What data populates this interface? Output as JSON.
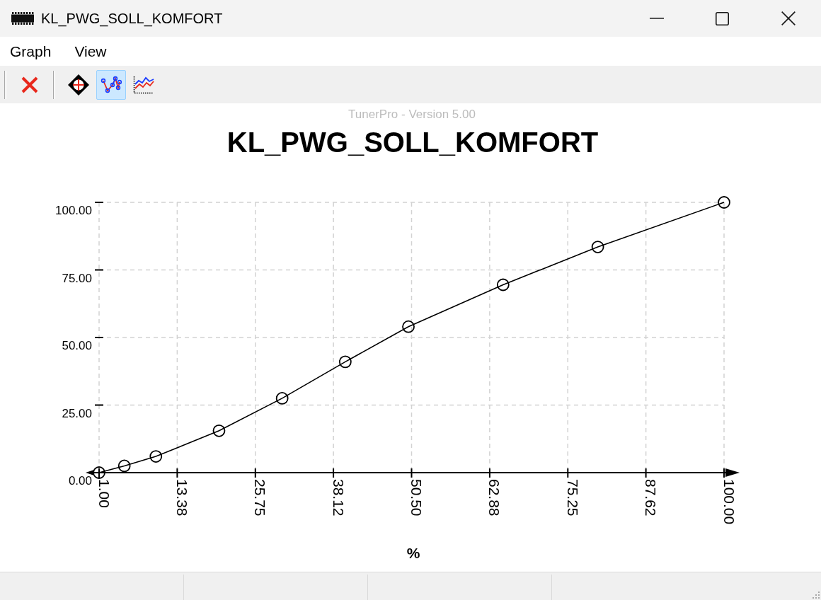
{
  "window": {
    "title": "KL_PWG_SOLL_KOMFORT"
  },
  "menu": [
    "Graph",
    "View"
  ],
  "toolbar": [
    {
      "buttons": [
        {
          "kind": "delete",
          "selected": false
        }
      ]
    },
    {
      "buttons": [
        {
          "kind": "crosshair",
          "selected": false
        },
        {
          "kind": "points",
          "selected": true
        },
        {
          "kind": "graph",
          "selected": false
        }
      ]
    }
  ],
  "graph": {
    "caption": "TunerPro - Version 5.00",
    "chart_data": {
      "type": "line",
      "title": "KL_PWG_SOLL_KOMFORT",
      "xlabel": "%",
      "grid": true,
      "x": [
        1,
        5,
        10,
        20,
        30,
        40,
        50,
        65,
        80,
        100
      ],
      "series": [
        {
          "color": "#000000",
          "marker": "circle",
          "values": [
            0,
            2.5,
            6,
            15.5,
            27.5,
            41,
            54,
            69.5,
            83.5,
            100
          ]
        }
      ],
      "xlim": [
        1,
        100
      ],
      "ylim": [
        0,
        100
      ],
      "xticks": [
        {
          "value": 1,
          "label": "1.00"
        },
        {
          "value": 13.375,
          "label": "13.38"
        },
        {
          "value": 25.75,
          "label": "25.75"
        },
        {
          "value": 38.125,
          "label": "38.12"
        },
        {
          "value": 50.5,
          "label": "50.50"
        },
        {
          "value": 62.875,
          "label": "62.88"
        },
        {
          "value": 75.25,
          "label": "75.25"
        },
        {
          "value": 87.625,
          "label": "87.62"
        },
        {
          "value": 100,
          "label": "100.00"
        }
      ],
      "yticks": [
        {
          "value": 0,
          "label": "0.00"
        },
        {
          "value": 25,
          "label": "25.00"
        },
        {
          "value": 50,
          "label": "50.00"
        },
        {
          "value": 75,
          "label": "75.00"
        },
        {
          "value": 100,
          "label": "100.00"
        }
      ]
    }
  }
}
